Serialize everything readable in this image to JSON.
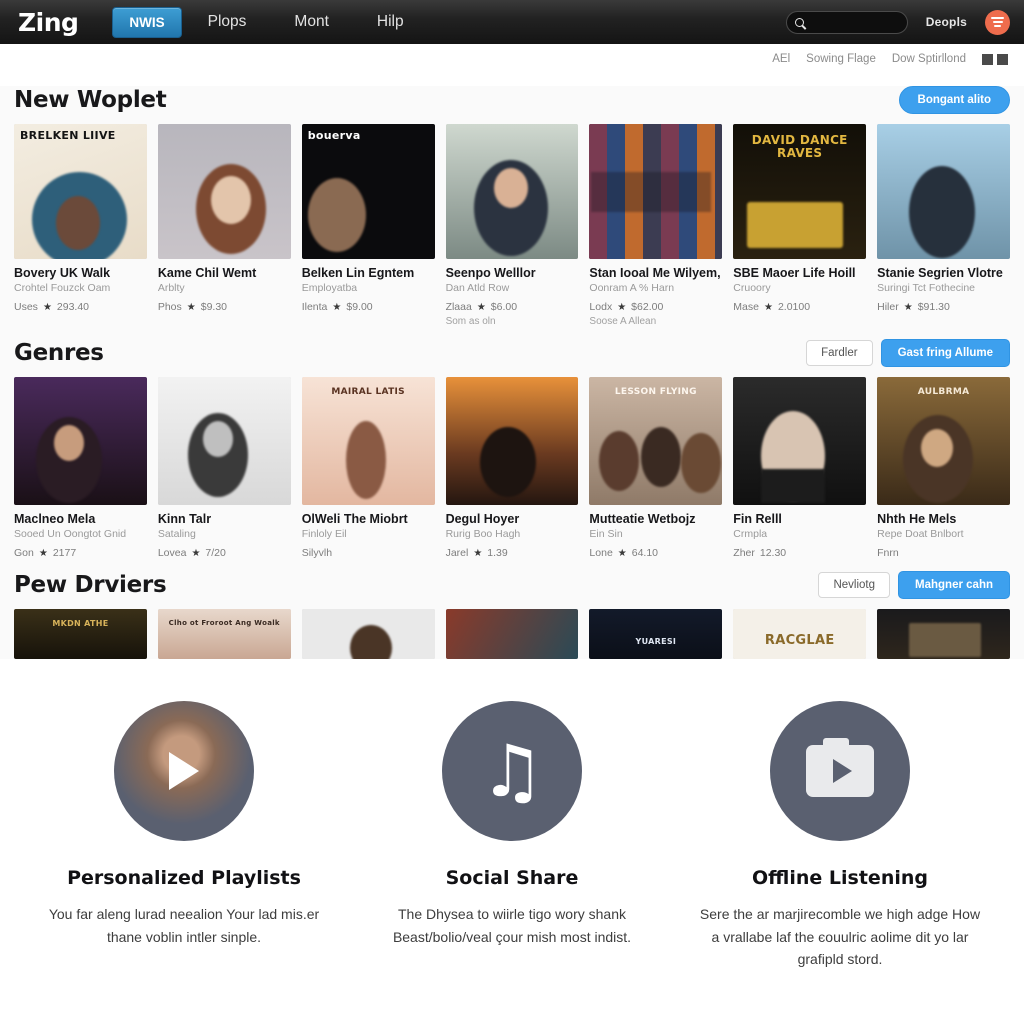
{
  "nav": {
    "brand": "Zing",
    "links": [
      {
        "label": "NWIS",
        "active": true
      },
      {
        "label": "Plops",
        "active": false
      },
      {
        "label": "Mont",
        "active": false
      },
      {
        "label": "Hilp",
        "active": false
      }
    ],
    "search_value": "",
    "search_placeholder": "",
    "user_label": "Deopls"
  },
  "subbar": {
    "item1": "AEl",
    "item2": "Sowing Flage",
    "item3": "Dow Sptirllond"
  },
  "sections": [
    {
      "title": "New Woplet",
      "primary_button": "Bongant alito",
      "secondary_button": ""
    },
    {
      "title": "Genres",
      "secondary_button": "Fardler",
      "primary_button": "Gast fring Allume"
    },
    {
      "title": "Pew Drviers",
      "secondary_button": "Nevliotg",
      "primary_button": "Mahgner cahn"
    }
  ],
  "new_releases": [
    {
      "art_text": "BRELKEN LIIVE",
      "title": "Bovery UK Walk",
      "sub": "Crohtel Fouzck Oam",
      "meta_label": "Uses",
      "price": "293.40",
      "extra": ""
    },
    {
      "art_text": "",
      "title": "Kame Chil Wemt",
      "sub": "Arblty",
      "meta_label": "Phos",
      "price": "$9.30",
      "extra": ""
    },
    {
      "art_text": "bouerva",
      "title": "Belken Lin Egntem",
      "sub": "Employatba",
      "meta_label": "Ilenta",
      "price": "$9.00",
      "extra": ""
    },
    {
      "art_text": "",
      "title": "Seenpo Welllor",
      "sub": "Dan Atld Row",
      "meta_label": "Zlaaa",
      "price": "$6.00",
      "extra": "Som as oln"
    },
    {
      "art_text": "",
      "title": "Stan Iooal Me Wilyem,",
      "sub": "Oonram A % Harn",
      "meta_label": "Lodx",
      "price": "$62.00",
      "extra": "Soose A Allean"
    },
    {
      "art_text": "DAVID DANCE RAVES",
      "title": "SBE Maoer Life Hoill",
      "sub": "Cruoory",
      "meta_label": "Mase",
      "price": "2.0100",
      "extra": ""
    },
    {
      "art_text": "",
      "title": "Stanie Segrien Vlotre",
      "sub": "Suringi Tct Fothecine",
      "meta_label": "Hiler",
      "price": "$91.30",
      "extra": ""
    }
  ],
  "genres": [
    {
      "art_text": "",
      "title": "Maclneo Mela",
      "sub": "Sooed Un Oongtot Gnid",
      "meta_label": "Gon",
      "price": "2177"
    },
    {
      "art_text": "",
      "title": "Kinn Talr",
      "sub": "Sataling",
      "meta_label": "Lovea",
      "price": "7/20"
    },
    {
      "art_text": "MAIRAL LATIS",
      "title": "OlWeli The Miobrt",
      "sub": "Finloly Eil",
      "meta_label": "Silyvlh",
      "price": ""
    },
    {
      "art_text": "",
      "title": "Degul Hoyer",
      "sub": "Rurig Boo Hagh",
      "meta_label": "Jarel",
      "price": "1.39"
    },
    {
      "art_text": "LESSON FLYING",
      "title": "Mutteatie Wetbojz",
      "sub": "Ein Sin",
      "meta_label": "Lone",
      "price": "64.10"
    },
    {
      "art_text": "",
      "title": "Fin Relll",
      "sub": "Crmpla",
      "meta_label": "Zher",
      "price": "12.30"
    },
    {
      "art_text": "AULBRMA",
      "title": "Nhth He Mels",
      "sub": "Repe Doat Bnlbort",
      "meta_label": "Fnrn",
      "price": ""
    }
  ],
  "drivers": [
    {
      "art_text": "MKDN ATHE"
    },
    {
      "art_text": "Clho ot Froroot Ang Woalk"
    },
    {
      "art_text": ""
    },
    {
      "art_text": ""
    },
    {
      "art_text": "YUARESI"
    },
    {
      "art_text": "RACGLAE"
    },
    {
      "art_text": ""
    }
  ],
  "features": [
    {
      "icon": "play-circle-icon",
      "title": "Personalized Playlists",
      "text": "You far aleng lurad neealion Your lad mis.er thane voblin intler sinple."
    },
    {
      "icon": "music-note-icon",
      "title": "Social Share",
      "text": "The Dhysea to wiirle tigo wory shank Beast/bolio/veal çour mish most indist."
    },
    {
      "icon": "media-player-icon",
      "title": "Offline Listening",
      "text": "Sere the ar marjirecomble we high adge How a vrallabe laf the єouulric aolime dit yo lar grafipld stord."
    }
  ],
  "colors": {
    "accent_blue": "#3da0ee",
    "nav_active": "#2176ad",
    "avatar_orange": "#ee6c4d",
    "feature_icon": "#5a6070"
  }
}
